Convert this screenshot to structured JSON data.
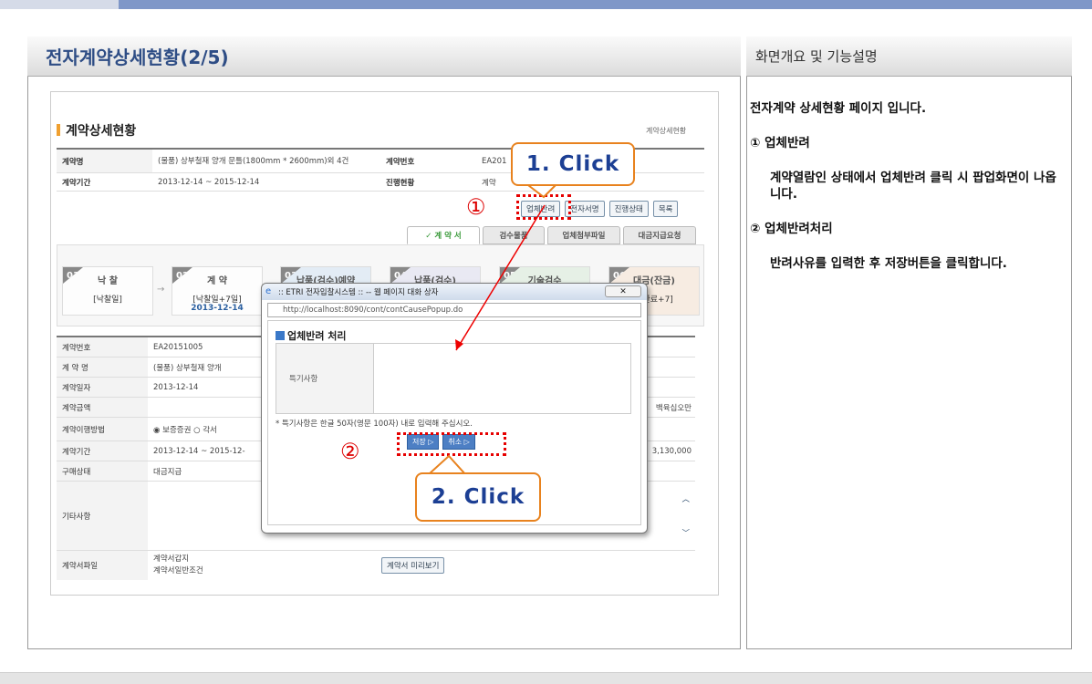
{
  "header": {
    "left_title": "전자계약상세현황(2/5)",
    "right_title": "화면개요 및 기능설명"
  },
  "app": {
    "section_title": "계약상세현황",
    "breadcrumb": "계약상세현황",
    "info_rows": [
      {
        "label": "계약명",
        "value": "(물품) 상부철재 양개 문틀(1800mm * 2600mm)외 4건",
        "label2": "계약번호",
        "value2": "EA201"
      },
      {
        "label": "계약기간",
        "value": "2013-12-14 ~ 2015-12-14",
        "label2": "진행현황",
        "value2": "계약"
      }
    ],
    "buttons": [
      "업체반려",
      "전자서명",
      "진행상태",
      "목록"
    ],
    "tabs": [
      "✓ 계 약 서",
      "검수물품",
      "업체첨부파일",
      "대금지급요청"
    ],
    "steps": [
      {
        "num": "01",
        "label": "낙 찰",
        "d1": "[낙찰일]",
        "d2": ""
      },
      {
        "num": "02",
        "label": "계 약",
        "d1": "[낙찰일+7일]",
        "d2": "2013-12-14"
      },
      {
        "num": "03",
        "label": "납품(검수)예약",
        "d1": "",
        "d2": ""
      },
      {
        "num": "04",
        "label": "납품(검수)",
        "d1": "",
        "d2": ""
      },
      {
        "num": "05",
        "label": "기술검수",
        "d1": "",
        "d2": ""
      },
      {
        "num": "06",
        "label": "대금(잔금)",
        "d1": "수완료+7]",
        "d2": ""
      }
    ],
    "detail_rows": [
      {
        "label": "계약번호",
        "value": "EA20151005",
        "right": ""
      },
      {
        "label": "계 약 명",
        "value": "(물품) 상부철재 양개",
        "right": ""
      },
      {
        "label": "계약일자",
        "value": "2013-12-14",
        "right": ""
      },
      {
        "label": "계약금액",
        "value": "",
        "right": "백육십오만"
      },
      {
        "label": "계약이행방법",
        "value": "◉ 보증증권 ○ 각서",
        "right": ""
      },
      {
        "label": "계약기간",
        "value": "2013-12-14 ~ 2015-12-",
        "right": "3,130,000"
      },
      {
        "label": "구매상태",
        "value": "대금지급",
        "right": ""
      },
      {
        "label": "기타사항",
        "value": "",
        "right": ""
      },
      {
        "label": "계약서파일",
        "value": "계약서갑지",
        "right": ""
      }
    ],
    "contract_file_extra": "계약서일반조건",
    "preview_button": "계약서 미리보기"
  },
  "popup": {
    "title": ":: ETRI 전자입찰시스템 :: -- 웹 페이지 대화 상자",
    "url": "http://localhost:8090/cont/contCausePopup.do",
    "heading": "업체반려 처리",
    "field_label": "특기사항",
    "note": "* 특기사항은 한글 50자(영문 100자) 내로 입력해 주십시오.",
    "save": "저장 ▷",
    "cancel": "취소 ▷"
  },
  "callouts": {
    "c1": "1. Click",
    "c2": "2. Click",
    "n1": "①",
    "n2": "②"
  },
  "description": {
    "intro": "전자계약 상세현황 페이지 입니다.",
    "item1_title": "① 업체반려",
    "item1_text": "계약열람인 상태에서 업체반려 클릭 시 팝업화면이 나옵니다.",
    "item2_title": "② 업체반려처리",
    "item2_text": "반려사유를 입력한 후 저장버튼을 클릭합니다."
  }
}
